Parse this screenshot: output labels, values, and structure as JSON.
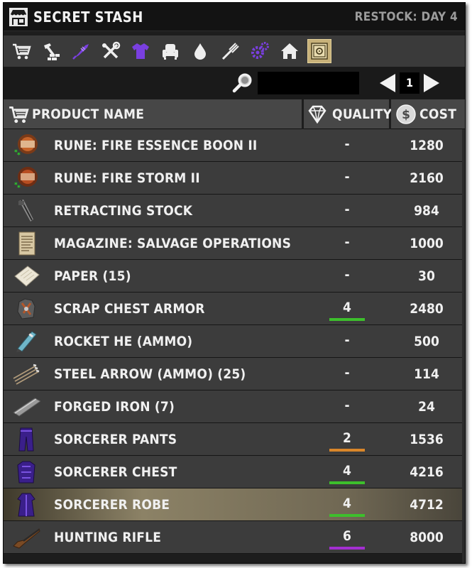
{
  "window": {
    "title": "SECRET STASH",
    "restock": "RESTOCK: DAY 4"
  },
  "categories": [
    {
      "name": "cart",
      "selected": false
    },
    {
      "name": "building",
      "selected": false
    },
    {
      "name": "magic",
      "selected": false
    },
    {
      "name": "tools",
      "selected": false
    },
    {
      "name": "clothing",
      "selected": false
    },
    {
      "name": "furniture",
      "selected": false
    },
    {
      "name": "water",
      "selected": false
    },
    {
      "name": "food",
      "selected": false
    },
    {
      "name": "parts",
      "selected": false
    },
    {
      "name": "home",
      "selected": false
    },
    {
      "name": "safe",
      "selected": true
    }
  ],
  "search": {
    "value": "",
    "placeholder": ""
  },
  "pager": {
    "current": "1"
  },
  "table": {
    "col_name": "PRODUCT NAME",
    "col_quality": "QUALITY",
    "col_cost": "COST",
    "rows": [
      {
        "icon": "rune-fire-essence-icon",
        "name": "RUNE: FIRE ESSENCE BOON II",
        "quality": "-",
        "cost": "1280",
        "bar_color": null,
        "selected": false
      },
      {
        "icon": "rune-fire-storm-icon",
        "name": "RUNE: FIRE STORM II",
        "quality": "-",
        "cost": "2160",
        "bar_color": null,
        "selected": false
      },
      {
        "icon": "retracting-stock-icon",
        "name": "RETRACTING STOCK",
        "quality": "-",
        "cost": "984",
        "bar_color": null,
        "selected": false
      },
      {
        "icon": "magazine-icon",
        "name": "MAGAZINE: SALVAGE OPERATIONS",
        "quality": "-",
        "cost": "1000",
        "bar_color": null,
        "selected": false
      },
      {
        "icon": "paper-icon",
        "name": "PAPER (15)",
        "quality": "-",
        "cost": "30",
        "bar_color": null,
        "selected": false
      },
      {
        "icon": "scrap-chest-armor-icon",
        "name": "SCRAP CHEST ARMOR",
        "quality": "4",
        "cost": "2480",
        "bar_color": "#3dbf2c",
        "selected": false
      },
      {
        "icon": "rocket-icon",
        "name": "ROCKET HE (AMMO)",
        "quality": "-",
        "cost": "500",
        "bar_color": null,
        "selected": false
      },
      {
        "icon": "steel-arrow-icon",
        "name": "STEEL ARROW (AMMO) (25)",
        "quality": "-",
        "cost": "114",
        "bar_color": null,
        "selected": false
      },
      {
        "icon": "forged-iron-icon",
        "name": "FORGED IRON (7)",
        "quality": "-",
        "cost": "24",
        "bar_color": null,
        "selected": false
      },
      {
        "icon": "sorcerer-pants-icon",
        "name": "SORCERER PANTS",
        "quality": "2",
        "cost": "1536",
        "bar_color": "#d9862a",
        "selected": false
      },
      {
        "icon": "sorcerer-chest-icon",
        "name": "SORCERER CHEST",
        "quality": "4",
        "cost": "4216",
        "bar_color": "#3dbf2c",
        "selected": false
      },
      {
        "icon": "sorcerer-robe-icon",
        "name": "SORCERER ROBE",
        "quality": "4",
        "cost": "4712",
        "bar_color": "#3dbf2c",
        "selected": true
      },
      {
        "icon": "hunting-rifle-icon",
        "name": "HUNTING RIFLE",
        "quality": "6",
        "cost": "8000",
        "bar_color": "#a32fd0",
        "selected": false
      }
    ]
  }
}
